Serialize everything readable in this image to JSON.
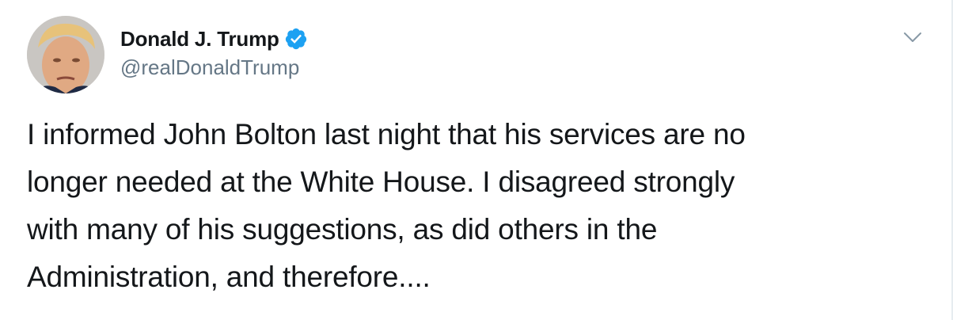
{
  "author": {
    "display_name": "Donald J. Trump",
    "handle": "@realDonaldTrump",
    "verified": true
  },
  "tweet": {
    "text": "I informed John Bolton last night that his services are no\nlonger needed at the White House. I disagreed strongly\nwith many of his suggestions, as did others in the\nAdministration, and therefore...."
  },
  "icons": {
    "verified": "verified-badge-icon",
    "menu": "chevron-down-icon"
  },
  "colors": {
    "verified": "#1da1f2",
    "text": "#14171a",
    "secondary": "#657786"
  }
}
